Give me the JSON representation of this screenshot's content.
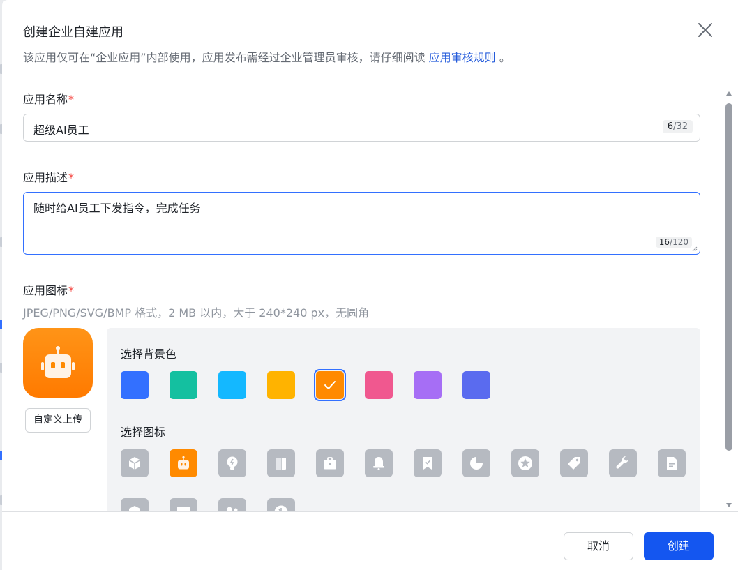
{
  "dialog": {
    "title": "创建企业自建应用",
    "subtitle_prefix": "该应用仅可在“企业应用”内部使用，应用发布需经过企业管理员审核，请仔细阅读 ",
    "subtitle_link": "应用审核规则",
    "subtitle_suffix": " 。",
    "close_icon": "close-icon"
  },
  "form": {
    "name": {
      "label": "应用名称",
      "required_mark": "*",
      "value": "超级AI员工",
      "count": "6",
      "max": "/32"
    },
    "description": {
      "label": "应用描述",
      "required_mark": "*",
      "value": "随时给AI员工下发指令，完成任务",
      "count": "16",
      "max": "/120"
    },
    "icon": {
      "label": "应用图标",
      "required_mark": "*",
      "hint": "JPEG/PNG/SVG/BMP 格式，2 MB 以内，大于 240*240 px，无圆角",
      "upload_label": "自定义上传",
      "background_title": "选择背景色",
      "icon_title": "选择图标",
      "background_colors": [
        "#3370ff",
        "#14c0a0",
        "#14b8ff",
        "#ffb300",
        "#ff8a00",
        "#f0588f",
        "#a66ef5",
        "#5a6bef"
      ],
      "selected_color": "#ff8a00",
      "icons_row1": [
        "cube-icon",
        "robot-icon",
        "lightbulb-icon",
        "door-icon",
        "briefcase-icon",
        "bell-icon",
        "bookmark-check-icon",
        "pie-chart-icon",
        "star-icon",
        "tag-icon",
        "wrench-icon",
        "document-icon"
      ],
      "icons_row2": [
        "shield-icon",
        "monitor-icon",
        "people-icon",
        "gauge-icon"
      ],
      "selected_icon": "robot-icon"
    }
  },
  "footer": {
    "cancel_label": "取消",
    "create_label": "创建"
  },
  "colors": {
    "primary": "#1456f0",
    "link": "#245bdb",
    "required": "#f54a45",
    "icon_tile": "#b6bac1"
  }
}
